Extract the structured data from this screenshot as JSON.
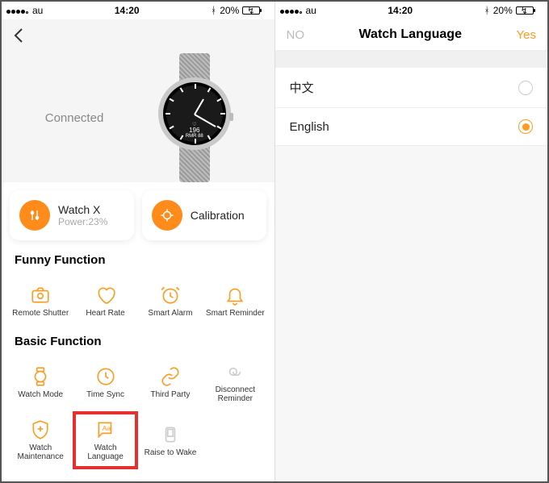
{
  "status": {
    "carrier": "au",
    "time": "14:20",
    "battery_pct": "20%"
  },
  "left": {
    "connected": "Connected",
    "card1": {
      "title": "Watch X",
      "sub": "Power:23%"
    },
    "card2": {
      "title": "Calibration"
    },
    "section1": "Funny Function",
    "funny": [
      "Remote Shutter",
      "Heart Rate",
      "Smart Alarm",
      "Smart Reminder"
    ],
    "section2": "Basic Function",
    "basic": [
      "Watch Mode",
      "Time Sync",
      "Third Party",
      "Disconnect Reminder",
      "Watch Maintenance",
      "Watch Language",
      "Raise to Wake"
    ]
  },
  "right": {
    "no": "NO",
    "title": "Watch Language",
    "yes": "Yes",
    "opt1": "中文",
    "opt2": "English"
  },
  "watch": {
    "hr_label": "♡",
    "hr_val": "196",
    "hr_unit": "RMR 88"
  }
}
